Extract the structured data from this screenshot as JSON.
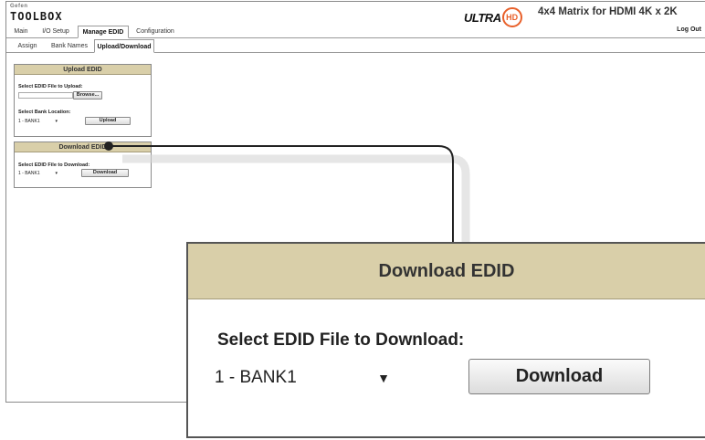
{
  "brand": {
    "small": "Gefen",
    "big": "TOOLBOX"
  },
  "header": {
    "ultra_word": "ULTRA",
    "ultra_hd": "HD",
    "product_title": "4x4 Matrix for HDMI 4K x 2K",
    "logout_label": "Log Out"
  },
  "tabs": [
    {
      "label": "Main"
    },
    {
      "label": "I/O Setup"
    },
    {
      "label": "Manage EDID"
    },
    {
      "label": "Configuration"
    }
  ],
  "subtabs": [
    {
      "label": "Assign"
    },
    {
      "label": "Bank Names"
    },
    {
      "label": "Upload/Download"
    }
  ],
  "upload_panel": {
    "title": "Upload EDID",
    "file_label": "Select EDID File to Upload:",
    "file_value": "",
    "browse_label": "Browse...",
    "bank_label": "Select Bank Location:",
    "bank_value": "1 - BANK1",
    "upload_label": "Upload"
  },
  "download_panel": {
    "title": "Download EDID",
    "file_label": "Select EDID File to Download:",
    "bank_value": "1 - BANK1",
    "download_label": "Download"
  },
  "icons": {
    "dropdown": "chevron-down-icon"
  },
  "colors": {
    "panel_header": "#d9cfa9",
    "hd_accent": "#e8602a",
    "connector": "#222222"
  }
}
